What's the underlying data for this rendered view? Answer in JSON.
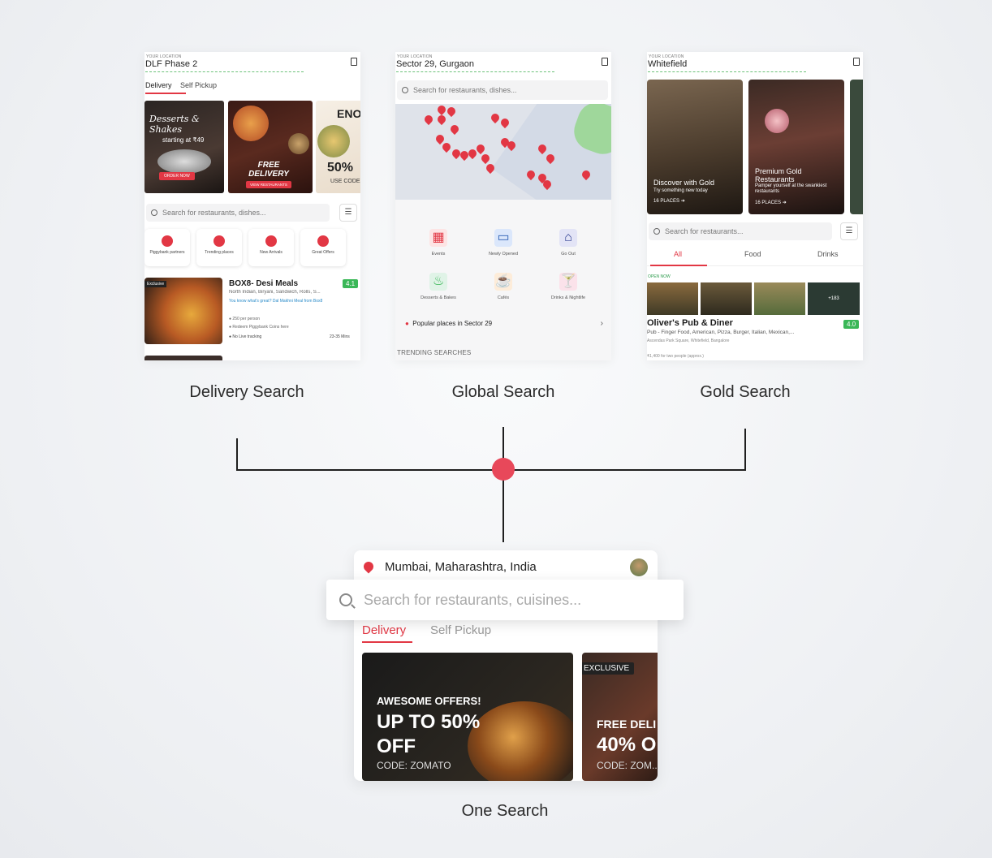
{
  "colors": {
    "accent": "#e23744",
    "rating": "#3ab757",
    "connector": "#1f1f1f"
  },
  "delivery": {
    "location_label": "YOUR LOCATION",
    "location": "DLF Phase 2",
    "tabs": [
      "Delivery",
      "Self Pickup"
    ],
    "banners": [
      {
        "title": "Desserts & Shakes",
        "sub": "starting at ₹49",
        "cta": "ORDER NOW"
      },
      {
        "title": "FREE DELIVERY",
        "cta": "VIEW RESTAURANTS"
      },
      {
        "title": "ENO",
        "pct": "50%",
        "code": "USE CODE"
      }
    ],
    "search_placeholder": "Search for restaurants, dishes...",
    "categories": [
      "Piggybank partners",
      "Trending places",
      "New Arrivals",
      "Great Offers"
    ],
    "restaurant": {
      "badge": "Exclusive",
      "name": "BOX8- Desi Meals",
      "rating": "4.1",
      "cuisines": "North Indian, Biryani, Sandwich, Rolls, S...",
      "promo": "You know what's great? Dal Makhni Meal from Box8",
      "price": "250 per person",
      "piggy": "Redeem Piggybank Coins here",
      "tracking": "No Live tracking",
      "time": "23-35 Mins"
    },
    "caption": "Delivery Search"
  },
  "global": {
    "location_label": "YOUR LOCATION",
    "location": "Sector 29, Gurgaon",
    "search_placeholder": "Search for restaurants, dishes...",
    "icons": [
      {
        "label": "Events",
        "icon": "calendar-icon"
      },
      {
        "label": "Newly Opened",
        "icon": "billboard-icon"
      },
      {
        "label": "Go Out",
        "icon": "storefront-icon"
      },
      {
        "label": "Desserts & Bakes",
        "icon": "cupcake-icon"
      },
      {
        "label": "Cafés",
        "icon": "coffee-icon"
      },
      {
        "label": "Drinks & Nightlife",
        "icon": "cocktail-icon"
      }
    ],
    "popular": "Popular places in Sector 29",
    "trending": "TRENDING SEARCHES",
    "caption": "Global Search"
  },
  "gold": {
    "location_label": "YOUR LOCATION",
    "location": "Whitefield",
    "cards": [
      {
        "title": "Discover with Gold",
        "sub": "Try something new today",
        "places": "16 PLACES"
      },
      {
        "title": "Premium Gold Restaurants",
        "sub": "Pamper yourself at the swankiest restaurants",
        "places": "16 PLACES"
      }
    ],
    "search_placeholder": "Search for restaurants...",
    "tabs": [
      "All",
      "Food",
      "Drinks"
    ],
    "open_now": "OPEN NOW",
    "more_photos": "+183",
    "restaurant": {
      "name": "Oliver's Pub & Diner",
      "rating": "4.0",
      "cuisines": "Pub - Finger Food, American, Pizza, Burger, Italian, Mexican,...",
      "address": "Ascendas Park Square, Whitefield, Bangalore",
      "cost": "₹1,400 for two people (approx.)"
    },
    "caption": "Gold Search"
  },
  "one": {
    "location": "Mumbai, Maharashtra, India",
    "search_placeholder": "Search for restaurants, cuisines...",
    "tabs": [
      "Delivery",
      "Self Pickup"
    ],
    "banner1": {
      "kicker": "AWESOME OFFERS!",
      "line1": "UP TO 50%",
      "line2": "OFF",
      "code": "CODE: ZOMATO"
    },
    "banner2": {
      "badge": "EXCLUSIVE",
      "line1": "FREE DELI",
      "line2": "40% O",
      "code": "CODE: ZOM..."
    },
    "caption": "One Search"
  }
}
